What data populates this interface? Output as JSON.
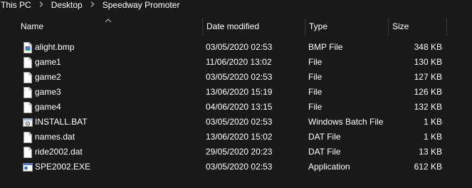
{
  "breadcrumb": {
    "items": [
      "This PC",
      "Desktop",
      "Speedway Promoter"
    ]
  },
  "columns": {
    "name": "Name",
    "date": "Date modified",
    "type": "Type",
    "size": "Size"
  },
  "files": [
    {
      "name": "alight.bmp",
      "date": "03/05/2020 02:53",
      "type": "BMP File",
      "size": "348 KB",
      "icon": "bitmap-file-icon"
    },
    {
      "name": "game1",
      "date": "11/06/2020 13:02",
      "type": "File",
      "size": "130 KB",
      "icon": "generic-file-icon"
    },
    {
      "name": "game2",
      "date": "03/05/2020 02:53",
      "type": "File",
      "size": "127 KB",
      "icon": "generic-file-icon"
    },
    {
      "name": "game3",
      "date": "13/06/2020 15:19",
      "type": "File",
      "size": "126 KB",
      "icon": "generic-file-icon"
    },
    {
      "name": "game4",
      "date": "04/06/2020 13:15",
      "type": "File",
      "size": "132 KB",
      "icon": "generic-file-icon"
    },
    {
      "name": "INSTALL.BAT",
      "date": "03/05/2020 02:53",
      "type": "Windows Batch File",
      "size": "1 KB",
      "icon": "batch-file-icon"
    },
    {
      "name": "names.dat",
      "date": "13/06/2020 15:02",
      "type": "DAT File",
      "size": "1 KB",
      "icon": "generic-file-icon"
    },
    {
      "name": "ride2002.dat",
      "date": "29/05/2020 20:23",
      "type": "DAT File",
      "size": "13 KB",
      "icon": "generic-file-icon"
    },
    {
      "name": "SPE2002.EXE",
      "date": "03/05/2020 02:53",
      "type": "Application",
      "size": "612 KB",
      "icon": "application-icon"
    }
  ],
  "colors": {
    "background": "#191919",
    "text": "#ffffff",
    "separator": "#3a3a3a"
  }
}
